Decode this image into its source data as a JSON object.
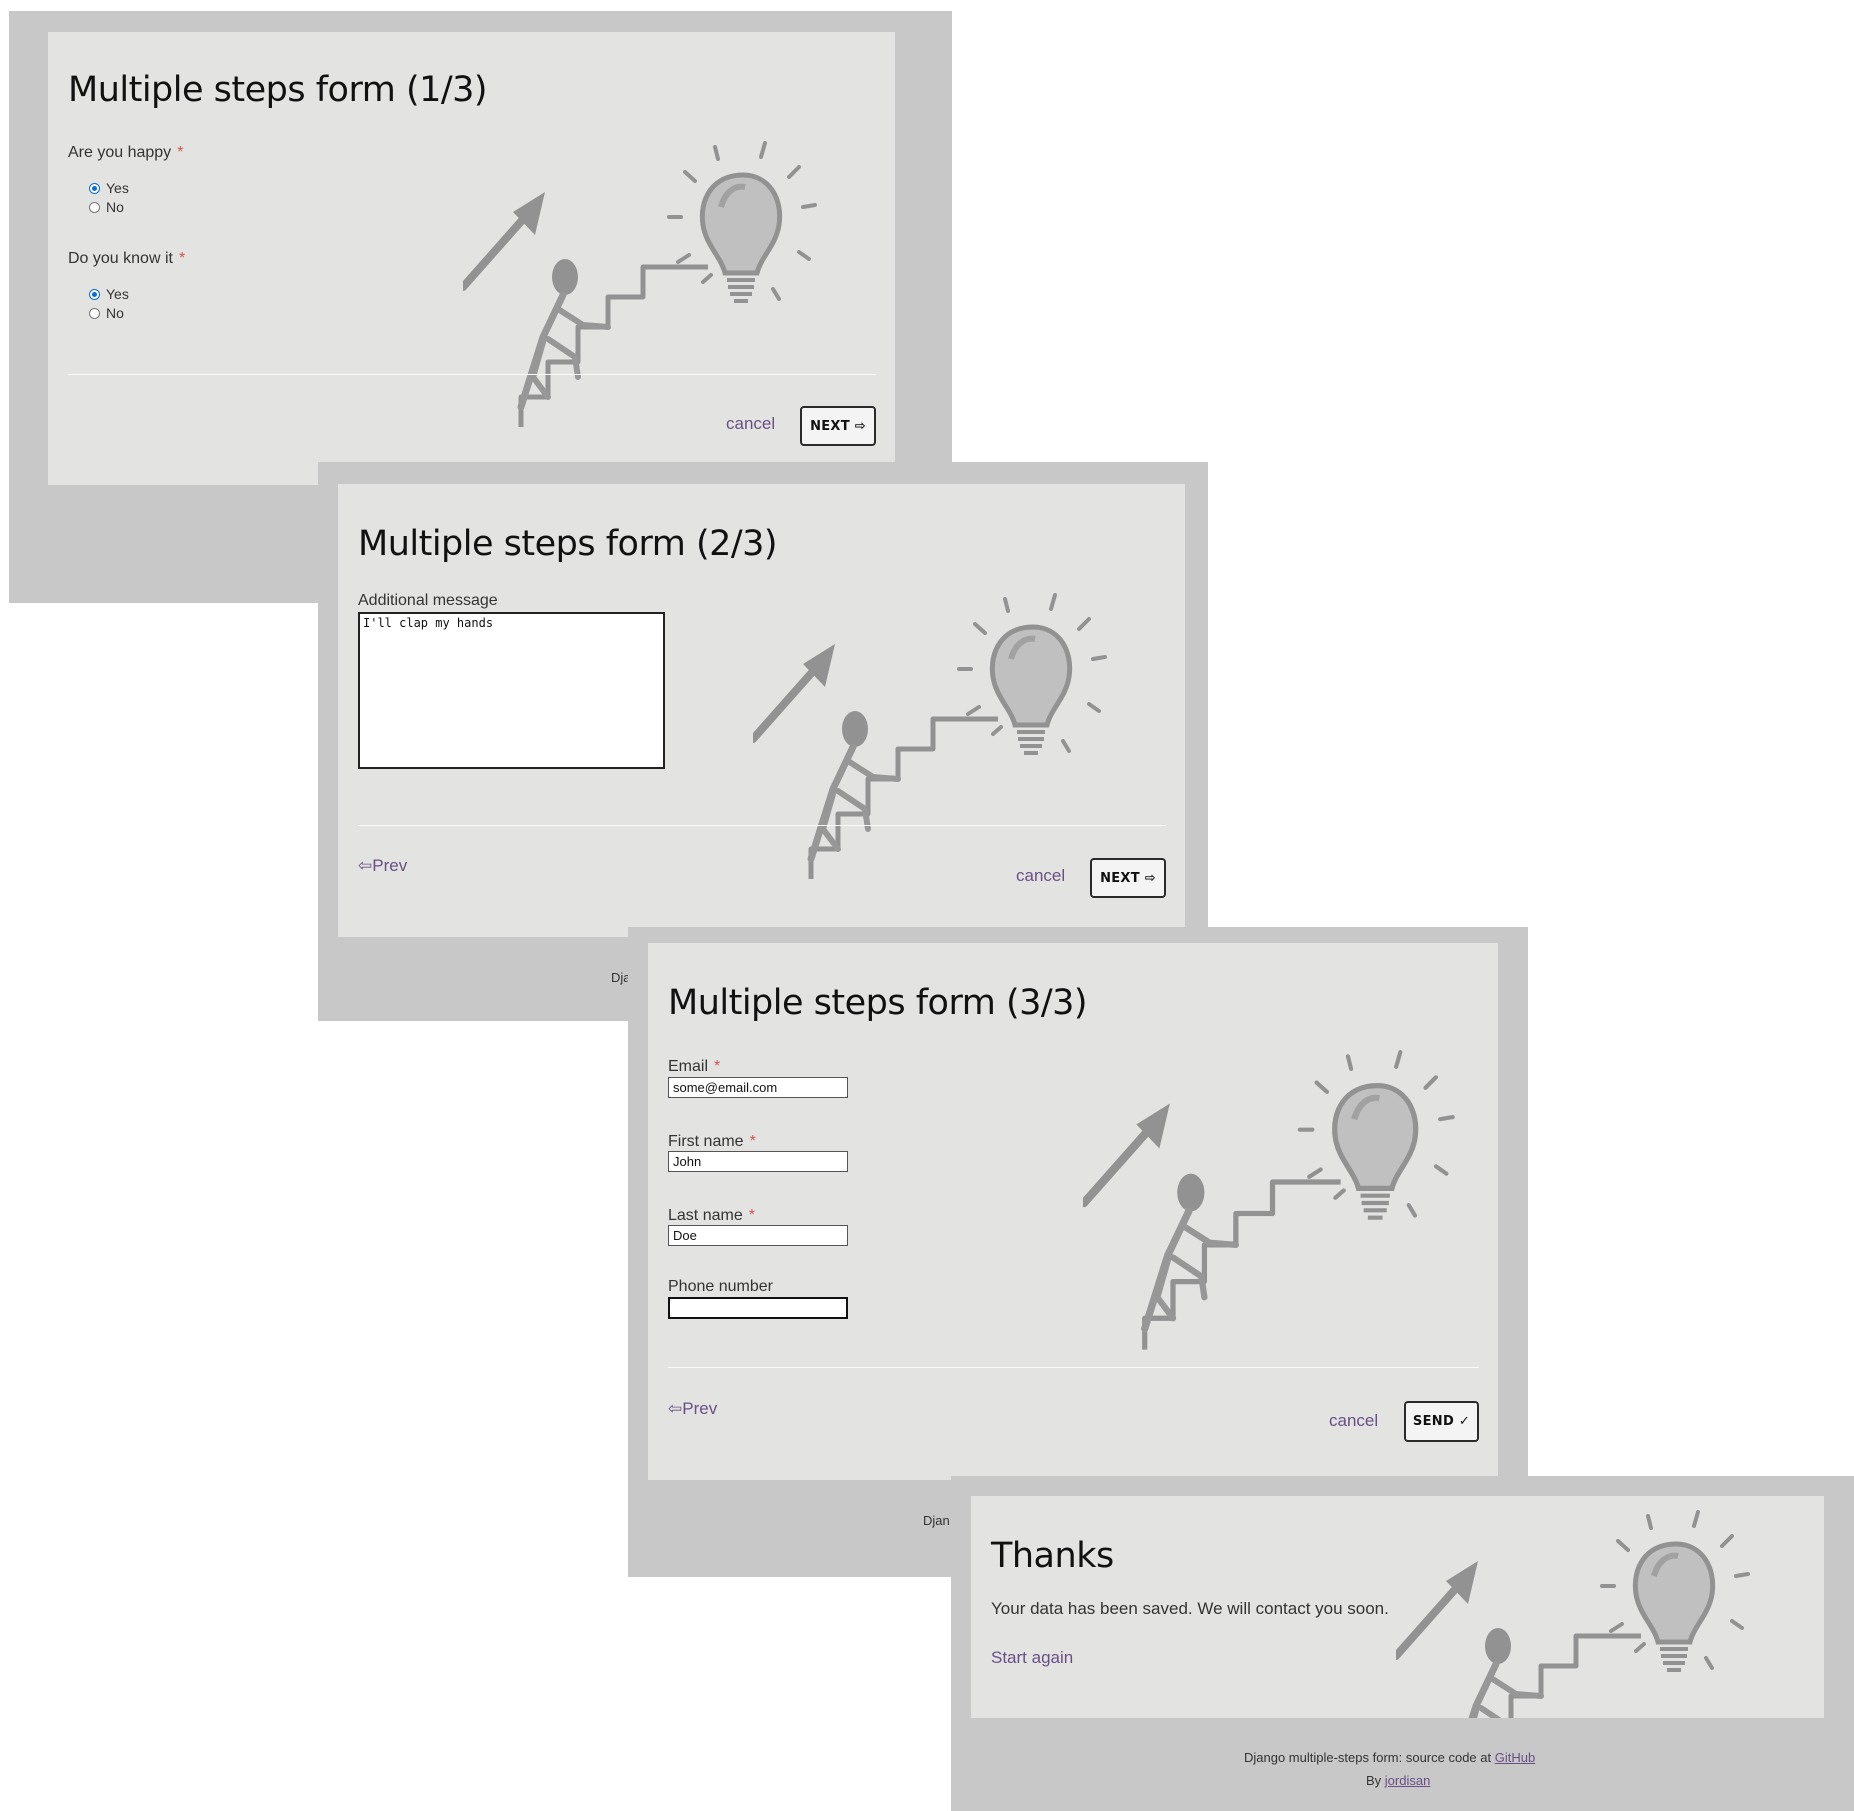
{
  "step1": {
    "title": "Multiple steps form (1/3)",
    "questions": [
      {
        "label": "Are you happy",
        "required_mark": "*",
        "options": [
          "Yes",
          "No"
        ],
        "selected": "Yes"
      },
      {
        "label": "Do you know it",
        "required_mark": "*",
        "options": [
          "Yes",
          "No"
        ],
        "selected": "Yes"
      }
    ],
    "cancel_label": "cancel",
    "next_label": "NEXT ⇨"
  },
  "step2": {
    "title": "Multiple steps form (2/3)",
    "message_label": "Additional message",
    "message_value": "I'll clap my hands",
    "prev_label": "⇦Prev",
    "cancel_label": "cancel",
    "next_label": "NEXT ⇨",
    "footer_partial": "Dja"
  },
  "step3": {
    "title": "Multiple steps form (3/3)",
    "fields": [
      {
        "label": "Email",
        "required_mark": "*",
        "value": "some@email.com"
      },
      {
        "label": "First name",
        "required_mark": "*",
        "value": "John"
      },
      {
        "label": "Last name",
        "required_mark": "*",
        "value": "Doe"
      },
      {
        "label": "Phone number",
        "required_mark": "",
        "value": ""
      }
    ],
    "prev_label": "⇦Prev",
    "cancel_label": "cancel",
    "send_label": "SEND ✓",
    "footer_partial": "Djan"
  },
  "thanks": {
    "title": "Thanks",
    "message": "Your data has been saved. We will contact you soon.",
    "start_again": "Start again",
    "footer_line1": "Django multiple-steps form: source code at",
    "footer_github": "GitHub",
    "footer_by": "By",
    "footer_author": "jordisan"
  },
  "icons": {
    "background_art": "lightbulb-stairs-illustration"
  },
  "colors": {
    "window_bg": "#c8c8c8",
    "card_bg": "#e3e4e2",
    "link": "#6a4f86",
    "required": "#d9534f",
    "radio_selected": "#0a6cd8"
  }
}
